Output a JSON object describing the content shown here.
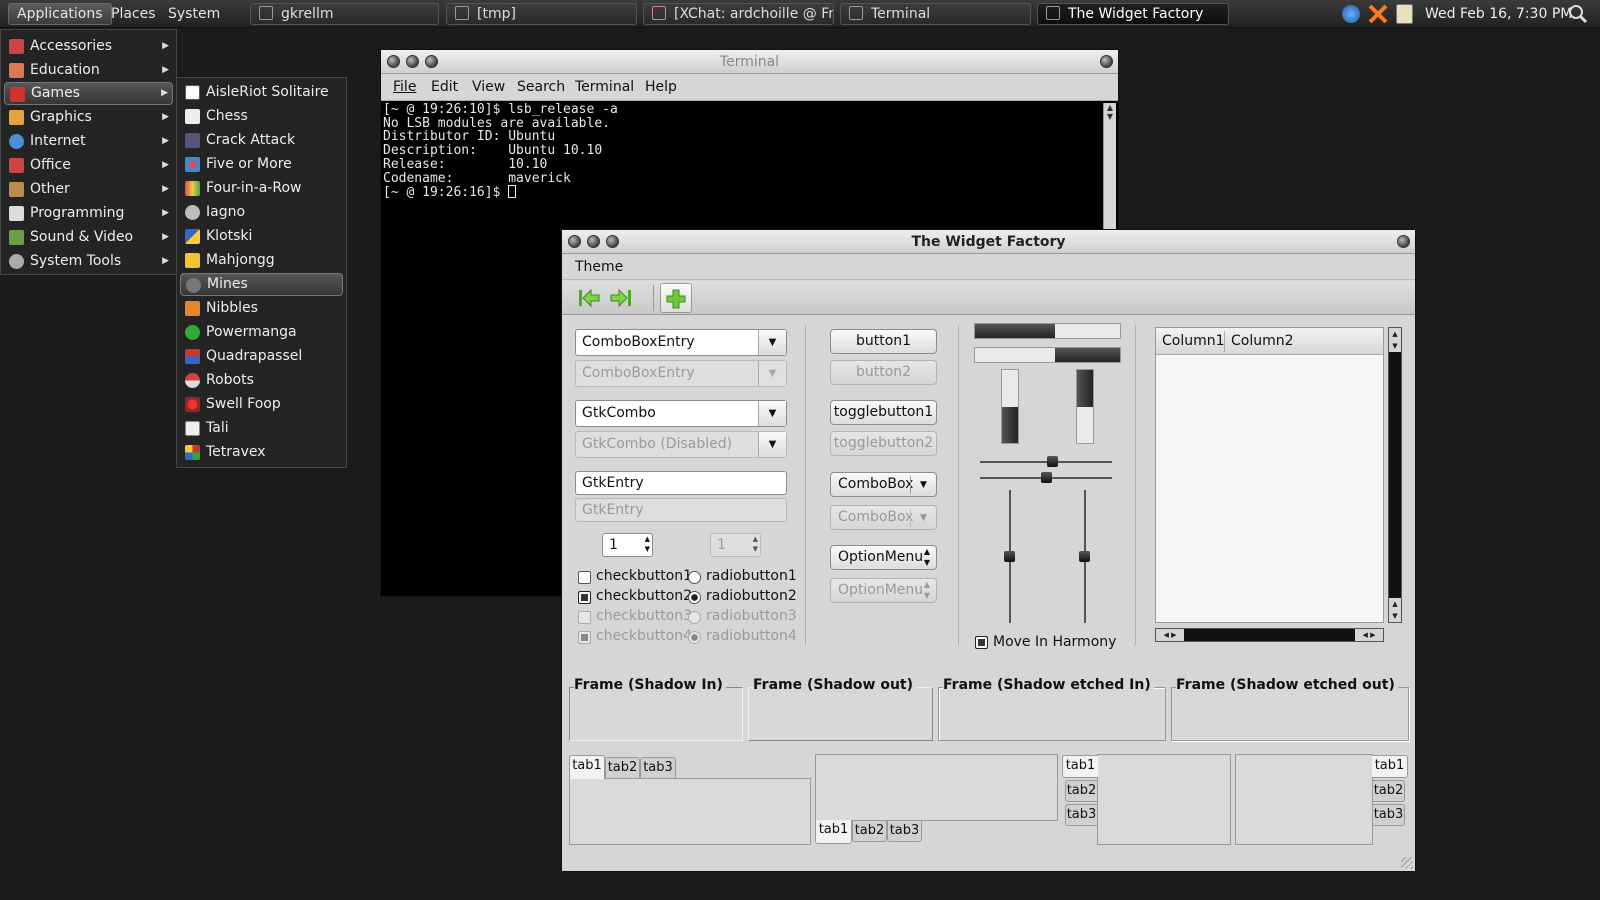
{
  "panel": {
    "menus": [
      "Applications",
      "Places",
      "System"
    ],
    "tasks": [
      "gkrellm",
      "[tmp]",
      "[XChat: ardchoille @ Fr...",
      "Terminal",
      "The Widget Factory"
    ],
    "clock": "Wed Feb 16,  7:30 PM"
  },
  "app_menu": {
    "items": [
      "Accessories",
      "Education",
      "Games",
      "Graphics",
      "Internet",
      "Office",
      "Other",
      "Programming",
      "Sound & Video",
      "System Tools"
    ],
    "selected": "Games"
  },
  "games_menu": {
    "items": [
      "AisleRiot Solitaire",
      "Chess",
      "Crack Attack",
      "Five or More",
      "Four-in-a-Row",
      "Iagno",
      "Klotski",
      "Mahjongg",
      "Mines",
      "Nibbles",
      "Powermanga",
      "Quadrapassel",
      "Robots",
      "Swell Foop",
      "Tali",
      "Tetravex"
    ],
    "selected": "Mines"
  },
  "terminal": {
    "title": "Terminal",
    "menu": [
      "File",
      "Edit",
      "View",
      "Search",
      "Terminal",
      "Help"
    ],
    "lines": [
      "[~ @ 19:26:10]$ lsb_release -a",
      "No LSB modules are available.",
      "Distributor ID: Ubuntu",
      "Description:    Ubuntu 10.10",
      "Release:        10.10",
      "Codename:       maverick",
      "[~ @ 19:26:16]$ "
    ]
  },
  "widget_factory": {
    "title": "The Widget Factory",
    "menu": "Theme",
    "combo_entry": "ComboBoxEntry",
    "combo_entry_disabled": "ComboBoxEntry",
    "gtkcombo": "GtkCombo",
    "gtkcombo_disabled": "GtkCombo (Disabled)",
    "entry": "GtkEntry",
    "entry_disabled": "GtkEntry",
    "spin1": "1",
    "spin2": "1",
    "checks": [
      "checkbutton1",
      "checkbutton2",
      "checkbutton3",
      "checkbutton4"
    ],
    "radios": [
      "radiobutton1",
      "radiobutton2",
      "radiobutton3",
      "radiobutton4"
    ],
    "button1": "button1",
    "button2": "button2",
    "toggle1": "togglebutton1",
    "toggle2": "togglebutton2",
    "combobox": "ComboBox",
    "combobox_disabled": "ComboBox",
    "optionmenu": "OptionMenu",
    "optionmenu_disabled": "OptionMenu",
    "progress_h": [
      0.55,
      0.45
    ],
    "progress_v": [
      0.5,
      0.5
    ],
    "hscale_values": [
      0.55,
      0.5
    ],
    "vscale_values": [
      0.5,
      0.5
    ],
    "harmony": "Move In Harmony",
    "columns": [
      "Column1",
      "Column2"
    ],
    "frames": [
      "Frame (Shadow In)",
      "Frame (Shadow out)",
      "Frame (Shadow etched In)",
      "Frame (Shadow etched out)"
    ],
    "tabs": [
      "tab1",
      "tab2",
      "tab3"
    ]
  }
}
